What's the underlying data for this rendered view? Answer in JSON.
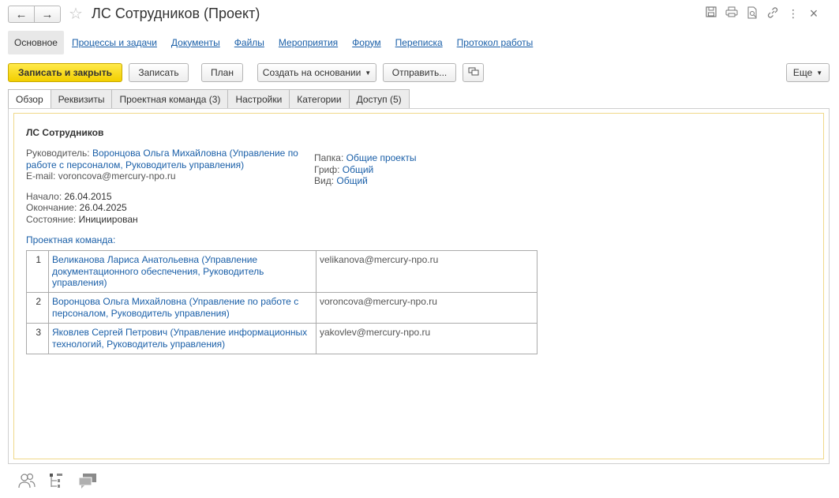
{
  "window": {
    "title": "ЛС Сотрудников (Проект)",
    "back_icon": "←",
    "forward_icon": "→",
    "favorite_icon": "☆"
  },
  "top_actions": {
    "save_icon": "save-icon",
    "print_icon": "print-icon",
    "preview_icon": "preview-icon",
    "link_icon": "link-icon",
    "more_icon": "⋮",
    "close_icon": "×"
  },
  "sections": [
    {
      "label": "Основное",
      "active": true
    },
    {
      "label": "Процессы и задачи"
    },
    {
      "label": "Документы"
    },
    {
      "label": "Файлы"
    },
    {
      "label": "Мероприятия"
    },
    {
      "label": "Форум"
    },
    {
      "label": "Переписка"
    },
    {
      "label": "Протокол работы"
    }
  ],
  "toolbar": {
    "save_close": "Записать и закрыть",
    "save": "Записать",
    "plan": "План",
    "create_based": "Создать на основании",
    "send": "Отправить...",
    "more": "Еще"
  },
  "tabs": [
    {
      "label": "Обзор",
      "active": true
    },
    {
      "label": "Реквизиты"
    },
    {
      "label": "Проектная команда (3)"
    },
    {
      "label": "Настройки"
    },
    {
      "label": "Категории"
    },
    {
      "label": "Доступ (5)"
    }
  ],
  "overview": {
    "title": "ЛС Сотрудников",
    "manager_label": "Руководитель:",
    "manager_line1": "Воронцова Ольга Михайловна (Управление по",
    "manager_line2": "работе с персоналом, Руководитель управления)",
    "email_label": "E-mail:",
    "email": "voroncova@mercury-npo.ru",
    "start_label": "Начало:",
    "start": "26.04.2015",
    "end_label": "Окончание:",
    "end": "26.04.2025",
    "state_label": "Состояние:",
    "state": "Инициирован",
    "folder_label": "Папка:",
    "folder": "Общие проекты",
    "grif_label": "Гриф:",
    "grif": "Общий",
    "kind_label": "Вид:",
    "kind": "Общий",
    "team_heading": "Проектная команда:"
  },
  "team": [
    {
      "num": "1",
      "person_lines": [
        "Великанова Лариса Анатольевна (Управление",
        "документационного обеспечения, Руководитель",
        "управления)"
      ],
      "email": "velikanova@mercury-npo.ru"
    },
    {
      "num": "2",
      "person_lines": [
        "Воронцова Ольга Михайловна (Управление по работе с",
        "персоналом, Руководитель управления)"
      ],
      "email": "voroncova@mercury-npo.ru"
    },
    {
      "num": "3",
      "person_lines": [
        "Яковлев Сергей Петрович (Управление информационных",
        "технологий, Руководитель управления)"
      ],
      "email": "yakovlev@mercury-npo.ru"
    }
  ],
  "bottom_icons": [
    "users-icon",
    "tree-icon",
    "discussion-icon"
  ]
}
